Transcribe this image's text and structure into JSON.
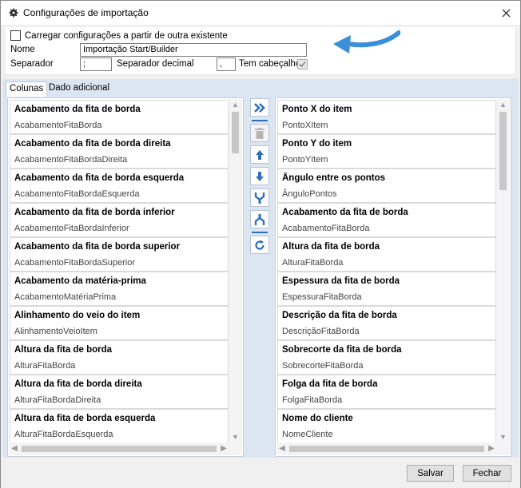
{
  "window": {
    "title": "Configurações de importação"
  },
  "form": {
    "load_from_existing_label": "Carregar configurações a partir de outra existente",
    "name_label": "Nome",
    "name_value": "Importação Start/Builder",
    "separator_label": "Separador",
    "separator_value": ";",
    "decimal_separator_label": "Separador decimal",
    "decimal_separator_value": ",",
    "has_header_label": "Tem cabeçalho",
    "has_header_checked": true
  },
  "tabs": [
    {
      "label": "Colunas",
      "active": true
    },
    {
      "label": "Dado adicional",
      "active": false
    }
  ],
  "available_columns": [
    {
      "title": "Acabamento da fita de borda",
      "field": "AcabamentoFitaBorda"
    },
    {
      "title": "Acabamento da fita de borda direita",
      "field": "AcabamentoFitaBordaDireita"
    },
    {
      "title": "Acabamento da fita de borda esquerda",
      "field": "AcabamentoFitaBordaEsquerda"
    },
    {
      "title": "Acabamento da fita de borda inferior",
      "field": "AcabamentoFitaBordaInferior"
    },
    {
      "title": "Acabamento da fita de borda superior",
      "field": "AcabamentoFitaBordaSuperior"
    },
    {
      "title": "Acabamento da matéria-prima",
      "field": "AcabamentoMatériaPrima"
    },
    {
      "title": "Alinhamento do veio do item",
      "field": "AlinhamentoVeioItem"
    },
    {
      "title": "Altura da fita de borda",
      "field": "AlturaFitaBorda"
    },
    {
      "title": "Altura da fita de borda direita",
      "field": "AlturaFitaBordaDireita"
    },
    {
      "title": "Altura da fita de borda esquerda",
      "field": "AlturaFitaBordaEsquerda"
    }
  ],
  "selected_columns": [
    {
      "title": "Ponto X do item",
      "field": "PontoXItem"
    },
    {
      "title": "Ponto Y do item",
      "field": "PontoYItem"
    },
    {
      "title": "Ângulo entre os pontos",
      "field": "ÂnguloPontos"
    },
    {
      "title": "Acabamento da fita de borda",
      "field": "AcabamentoFitaBorda"
    },
    {
      "title": "Altura da fita de borda",
      "field": "AlturaFitaBorda"
    },
    {
      "title": "Espessura da fita de borda",
      "field": "EspessuraFitaBorda"
    },
    {
      "title": "Descrição da fita de borda",
      "field": "DescriçãoFitaBorda"
    },
    {
      "title": "Sobrecorte da fita de borda",
      "field": "SobrecorteFitaBorda"
    },
    {
      "title": "Folga da fita de borda",
      "field": "FolgaFitaBorda"
    },
    {
      "title": "Nome do cliente",
      "field": "NomeCliente"
    }
  ],
  "toolbar": {
    "icons": [
      "move-all-right-icon",
      "delete-icon",
      "move-up-icon",
      "move-down-icon",
      "move-to-bottom-icon",
      "move-to-top-icon",
      "reset-icon"
    ]
  },
  "footer": {
    "save_label": "Salvar",
    "close_label": "Fechar"
  },
  "colors": {
    "accent": "#2f6fb7",
    "panel_bg": "#dbe6f2",
    "arrow_blue": "#3a8fd8"
  }
}
